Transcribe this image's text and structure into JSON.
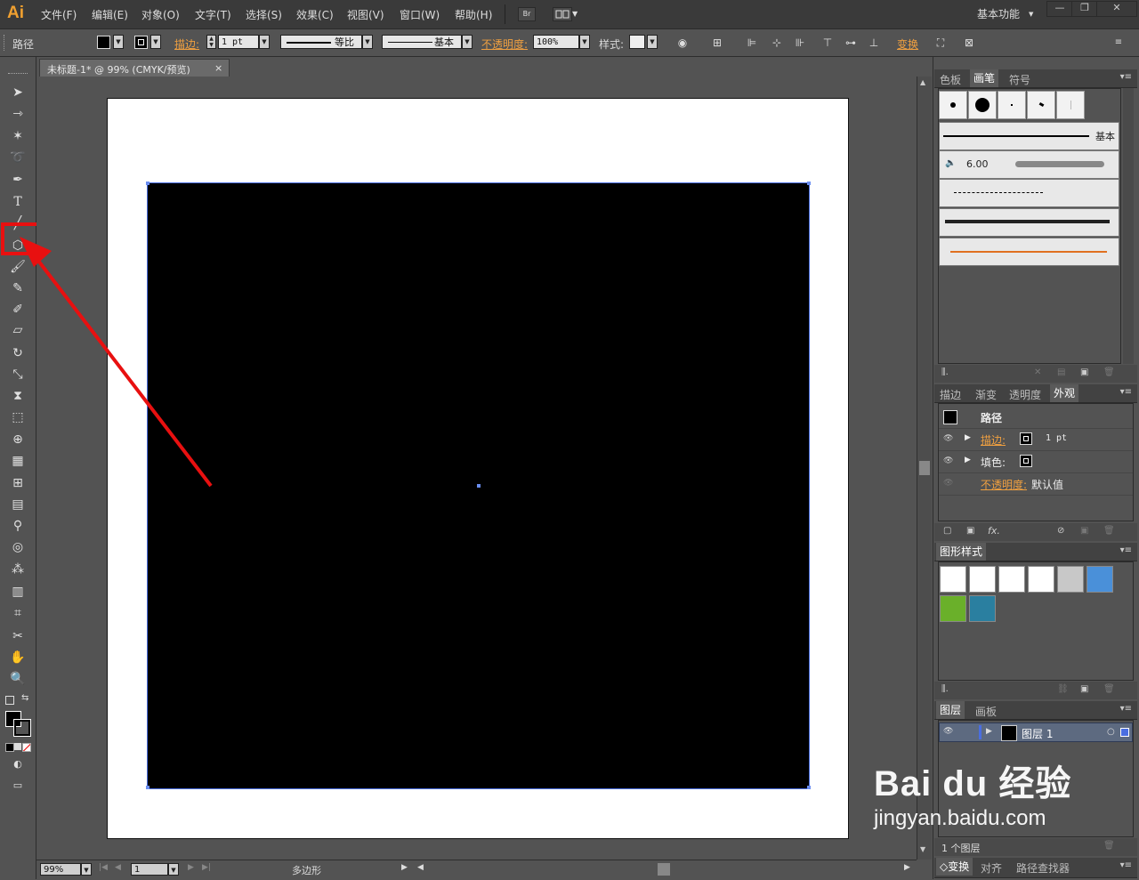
{
  "app": {
    "logo": "Ai",
    "workspace": "基本功能"
  },
  "menu": [
    "文件(F)",
    "编辑(E)",
    "对象(O)",
    "文字(T)",
    "选择(S)",
    "效果(C)",
    "视图(V)",
    "窗口(W)",
    "帮助(H)"
  ],
  "menubar_buttons": {
    "bridge": "Br"
  },
  "control": {
    "selection_type": "路径",
    "stroke_label": "描边:",
    "stroke_value": "1 pt",
    "profile_label": "等比",
    "brush_label": "基本",
    "opacity_label": "不透明度:",
    "opacity_value": "100%",
    "style_label": "样式:",
    "transform_label": "变换"
  },
  "document": {
    "tab_title": "未标题-1* @ 99% (CMYK/预览)",
    "close": "×"
  },
  "status": {
    "zoom": "99%",
    "artboard": "1",
    "tool_name": "多边形"
  },
  "panels": {
    "swatches_group": {
      "tabs": [
        "色板",
        "画笔",
        "符号"
      ],
      "active": "画笔"
    },
    "brush_rows": {
      "basic": "基本",
      "size": "6.00"
    },
    "appearance_group": {
      "tabs": [
        "描边",
        "渐变",
        "透明度",
        "外观"
      ],
      "active": "外观"
    },
    "appearance": {
      "header": "路径",
      "stroke_label": "描边:",
      "stroke_value": "1 pt",
      "fill_label": "填色:",
      "opacity_label": "不透明度:",
      "opacity_value": "默认值",
      "fx": "fx."
    },
    "graphic_styles": {
      "title": "图形样式"
    },
    "layers_group": {
      "tabs": [
        "图层",
        "画板"
      ],
      "active": "图层"
    },
    "layers": {
      "layer_name": "图层 1",
      "count": "1 个图层"
    },
    "bottom_group": {
      "tabs": [
        "◇变换",
        "对齐",
        "路径查找器"
      ]
    }
  },
  "watermark": {
    "brand": "Bai du 经验",
    "url": "jingyan.baidu.com"
  },
  "colors": {
    "accent_orange": "#f0a040",
    "highlight_red": "#e81010",
    "selection_blue": "#4a6ee0"
  }
}
